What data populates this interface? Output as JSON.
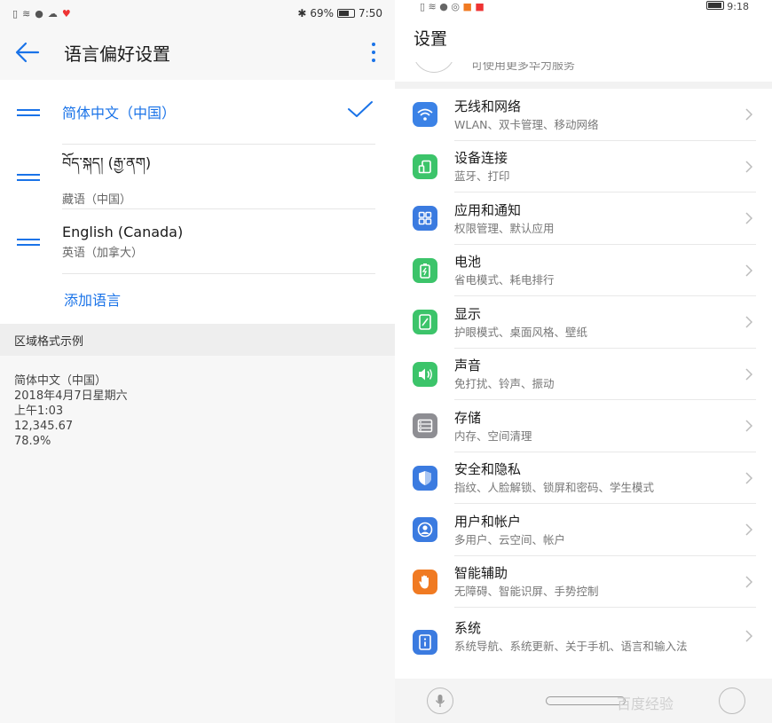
{
  "left": {
    "status": {
      "battery": "69%",
      "time": "7:50"
    },
    "header": {
      "title": "语言偏好设置"
    },
    "languages": [
      {
        "name": "简体中文（中国）",
        "sub": "",
        "active": true
      },
      {
        "name": "བོད་སྐད། (རྒྱ་ནག)",
        "sub": "藏语（中国）",
        "active": false
      },
      {
        "name": "English (Canada)",
        "sub": "英语（加拿大）",
        "active": false
      }
    ],
    "add_language": "添加语言",
    "region": {
      "header": "区域格式示例",
      "lines": [
        "简体中文（中国）",
        "2018年4月7日星期六",
        "上午1:03",
        "12,345.67",
        "78.9%"
      ]
    }
  },
  "right": {
    "status": {
      "time": "9:18"
    },
    "title": "设置",
    "account_sub": "可使用更多华为服务",
    "items": [
      {
        "title": "无线和网络",
        "sub": "WLAN、双卡管理、移动网络",
        "icon": "wifi-icon",
        "color": "#3b82e6"
      },
      {
        "title": "设备连接",
        "sub": "蓝牙、打印",
        "icon": "device-connect-icon",
        "color": "#3cc46a"
      },
      {
        "title": "应用和通知",
        "sub": "权限管理、默认应用",
        "icon": "apps-icon",
        "color": "#3b7be0"
      },
      {
        "title": "电池",
        "sub": "省电模式、耗电排行",
        "icon": "battery-icon",
        "color": "#3cc46a"
      },
      {
        "title": "显示",
        "sub": "护眼模式、桌面风格、壁纸",
        "icon": "display-icon",
        "color": "#3cc46a"
      },
      {
        "title": "声音",
        "sub": "免打扰、铃声、振动",
        "icon": "sound-icon",
        "color": "#3cc46a"
      },
      {
        "title": "存储",
        "sub": "内存、空间清理",
        "icon": "storage-icon",
        "color": "#8e8e93"
      },
      {
        "title": "安全和隐私",
        "sub": "指纹、人脸解锁、锁屏和密码、学生模式",
        "icon": "shield-icon",
        "color": "#3b7be0"
      },
      {
        "title": "用户和帐户",
        "sub": "多用户、云空间、帐户",
        "icon": "user-icon",
        "color": "#3b7be0"
      },
      {
        "title": "智能辅助",
        "sub": "无障碍、智能识屏、手势控制",
        "icon": "hand-icon",
        "color": "#f07a22"
      },
      {
        "title": "系统",
        "sub": "系统导航、系统更新、关于手机、语言和输入法",
        "icon": "info-icon",
        "color": "#3b7be0"
      }
    ],
    "watermark": "百度经验"
  }
}
